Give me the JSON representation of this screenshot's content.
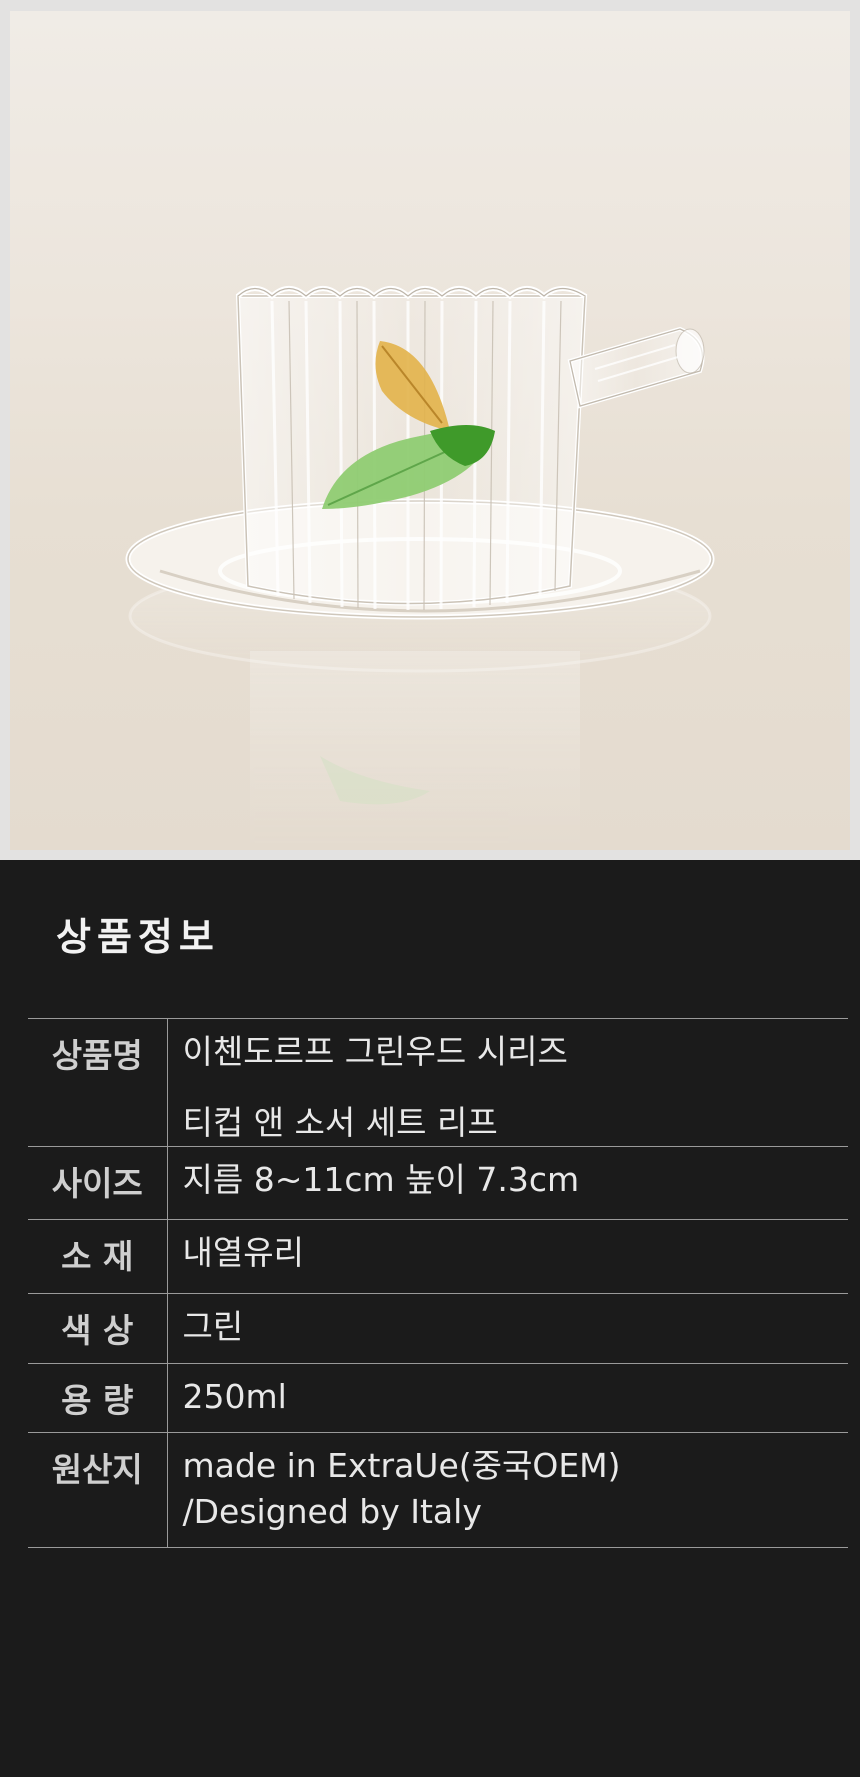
{
  "section_title": "상품정보",
  "spec_rows": [
    {
      "label": "상품명",
      "lines": [
        "이첸도르프 그린우드 시리즈",
        "티컵 앤 소서 세트 리프"
      ]
    },
    {
      "label": "사이즈",
      "lines": [
        "지름 8~11cm 높이 7.3cm"
      ]
    },
    {
      "label": "소 재",
      "lines": [
        "내열유리"
      ]
    },
    {
      "label": "색 상",
      "lines": [
        "그린"
      ]
    },
    {
      "label": "용 량",
      "lines": [
        "250ml"
      ]
    },
    {
      "label": "원산지",
      "lines": [
        "made in ExtraUe(중국OEM)",
        "/Designed by Italy"
      ]
    }
  ],
  "colors": {
    "background": "#1b1b1b",
    "border": "#9a9a9a",
    "photo_bg": "#ece5dc",
    "leaf_yellow": "#e2b24a",
    "leaf_green": "#8fcc72"
  }
}
